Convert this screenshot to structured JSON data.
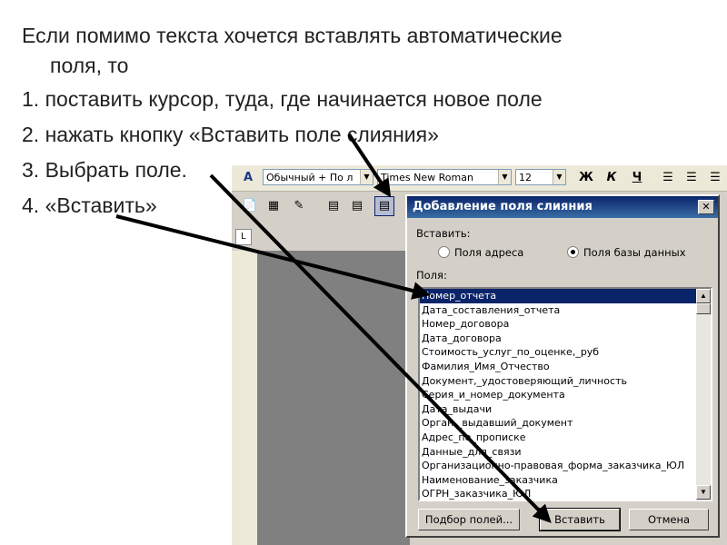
{
  "slide": {
    "lines": [
      "Если помимо текста хочется вставлять автоматические",
      "поля,  то",
      "1. поставить курсор, туда, где начинается новое поле",
      "2. нажать кнопку «Вставить поле слияния»",
      "3. Выбрать поле.",
      "4. «Вставить»"
    ]
  },
  "toolbar": {
    "style_combo": "Обычный + По л",
    "font_combo": "Times New Roman",
    "size_combo": "12",
    "bold_label": "Ж",
    "italic_label": "К",
    "underline_label": "Ч"
  },
  "ruler": {
    "tab_marker": "L"
  },
  "dialog": {
    "title": "Добавление поля слияния",
    "close_label": "✕",
    "insert_label": "Вставить:",
    "radio_address": "Поля адреса",
    "radio_database": "Поля базы данных",
    "selected_radio": "database",
    "fields_label": "Поля:",
    "fields": [
      "Номер_отчета",
      "Дата_составления_отчета",
      "Номер_договора",
      "Дата_договора",
      "Стоимость_услуг_по_оценке,_руб",
      "Фамилия_Имя_Отчество",
      "Документ,_удостоверяющий_личность",
      "Серия_и_номер_документа",
      "Дата_выдачи",
      "Орган,_выдавший_документ",
      "Адрес_по_прописке",
      "Данные_для_связи",
      "Организационно-правовая_форма_заказчика_ЮЛ",
      "Наименование_заказчика",
      "ОГРН_заказчика_ЮЛ"
    ],
    "selected_index": 0,
    "match_fields_button": "Подбор полей...",
    "insert_button": "Вставить",
    "cancel_button": "Отмена"
  },
  "colors": {
    "title_bar": "#0a246a",
    "selection": "#0a246a",
    "arrow": "#000000"
  }
}
